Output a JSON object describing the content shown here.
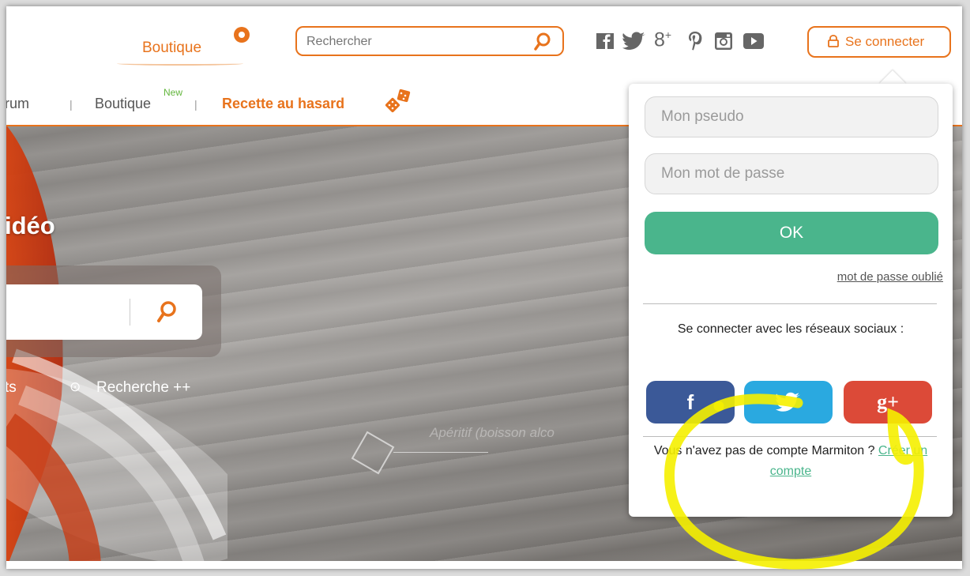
{
  "header": {
    "boutique_label": "Boutique",
    "search_placeholder": "Rechercher",
    "connect_label": "Se connecter"
  },
  "social_icons": [
    "facebook-icon",
    "twitter-icon",
    "google-plus-icon",
    "pinterest-icon",
    "instagram-icon",
    "youtube-icon"
  ],
  "nav": {
    "forum_label": "rum",
    "sep": "|",
    "boutique_label": "Boutique",
    "new_badge": "New",
    "random_recipe_label": "Recette au hasard"
  },
  "hero": {
    "title": "idéo",
    "link_left": "ts",
    "link_advanced": "Recherche ++",
    "watermark": "Apéritif (boisson alco"
  },
  "login": {
    "username_placeholder": "Mon pseudo",
    "password_placeholder": "Mon mot de passe",
    "ok_label": "OK",
    "forgot_label": "mot de passe oublié",
    "social_title": "Se connecter avec les réseaux sociaux :",
    "facebook_label": "f",
    "google_label": "g+",
    "no_account_text": "Vous n'avez pas de compte Marmiton ?",
    "create_account_label": "Créer un compte"
  },
  "colors": {
    "brand_orange": "#e8731c",
    "ok_green": "#4ab58c",
    "facebook": "#3b5998",
    "twitter": "#2aa9e0",
    "google": "#dc4a38",
    "highlight": "#f5f000"
  }
}
